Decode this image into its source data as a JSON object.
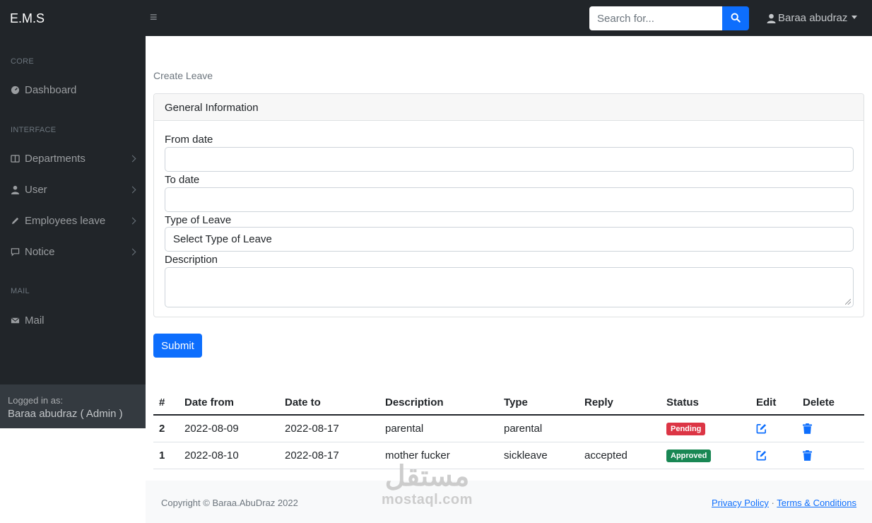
{
  "app": {
    "brand": "E.M.S"
  },
  "topbar": {
    "search_placeholder": "Search for...",
    "user_name": "Baraa abudraz"
  },
  "sidebar": {
    "sections": [
      {
        "heading": "CORE"
      },
      {
        "heading": "INTERFACE"
      },
      {
        "heading": "MAIL"
      }
    ],
    "items": [
      {
        "label": "Dashboard",
        "icon": "dashboard-icon"
      },
      {
        "label": "Departments",
        "icon": "columns-icon"
      },
      {
        "label": "User",
        "icon": "user-icon"
      },
      {
        "label": "Employees leave",
        "icon": "pencil-icon"
      },
      {
        "label": "Notice",
        "icon": "comment-icon"
      },
      {
        "label": "Mail",
        "icon": "envelope-icon"
      }
    ],
    "footer": {
      "label": "Logged in as:",
      "user": "Baraa abudraz ( Admin )"
    }
  },
  "main": {
    "page_title": "Create Leave",
    "card": {
      "header": "General Information",
      "fields": {
        "from_date": {
          "label": "From date",
          "value": ""
        },
        "to_date": {
          "label": "To date",
          "value": ""
        },
        "type": {
          "label": "Type of Leave",
          "selected": "Select Type of Leave"
        },
        "description": {
          "label": "Description",
          "value": ""
        }
      }
    },
    "submit_label": "Submit",
    "table": {
      "headers": [
        "#",
        "Date from",
        "Date to",
        "Description",
        "Type",
        "Reply",
        "Status",
        "Edit",
        "Delete"
      ],
      "rows": [
        {
          "id": "2",
          "date_from": "2022-08-09",
          "date_to": "2022-08-17",
          "description": "parental",
          "type": "parental",
          "reply": "",
          "status": "Pending"
        },
        {
          "id": "1",
          "date_from": "2022-08-10",
          "date_to": "2022-08-17",
          "description": "mother fucker",
          "type": "sickleave",
          "reply": "accepted",
          "status": "Approved"
        }
      ]
    }
  },
  "footer": {
    "copyright": "Copyright © Baraa.AbuDraz 2022",
    "privacy": "Privacy Policy",
    "separator": "·",
    "terms": "Terms & Conditions"
  },
  "watermark": {
    "arabic": "مستقل",
    "latin": "mostaql.com"
  },
  "colors": {
    "dark": "#212529",
    "primary": "#0d6efd",
    "danger": "#dc3545",
    "success": "#198754"
  }
}
